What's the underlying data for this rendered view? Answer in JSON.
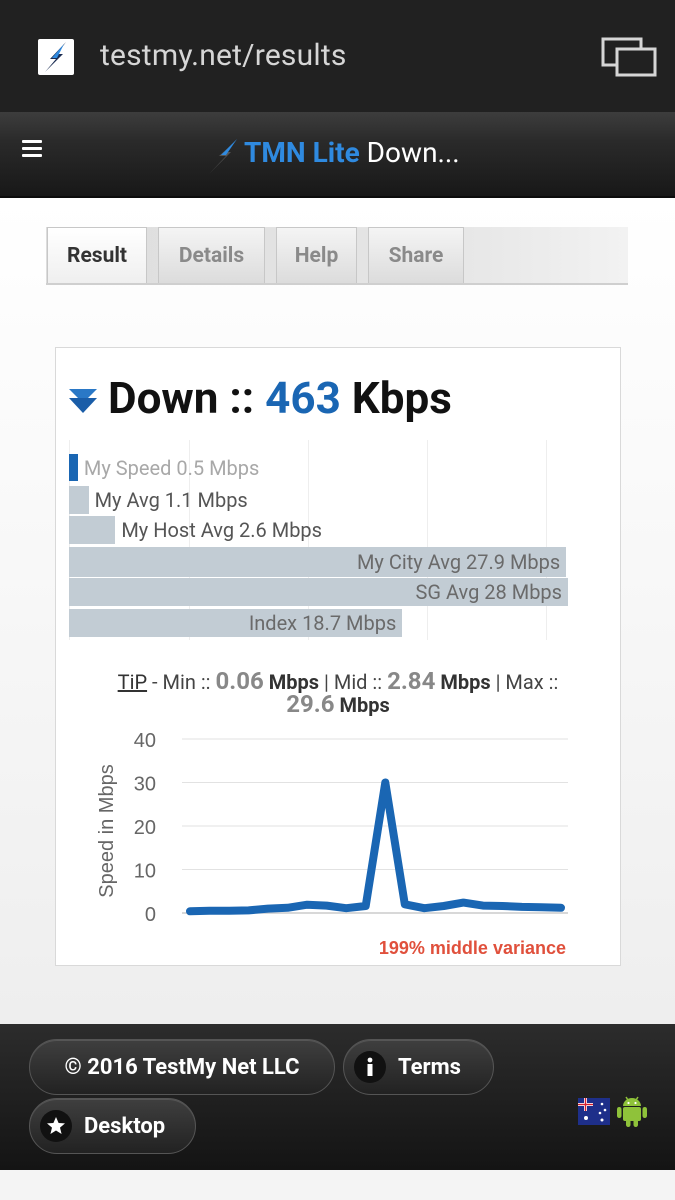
{
  "browser": {
    "url": "testmy.net/results"
  },
  "header": {
    "title_brand": "TMN Lite",
    "title_rest": " Down..."
  },
  "tabs": [
    {
      "label": "Result",
      "active": true
    },
    {
      "label": "Details",
      "active": false
    },
    {
      "label": "Help",
      "active": false
    },
    {
      "label": "Share",
      "active": false
    }
  ],
  "result": {
    "direction_label": "Down ::",
    "speed_value": "463",
    "speed_unit": "Kbps"
  },
  "comparison_bars": [
    {
      "label": "My Speed 0.5 Mbps",
      "value": 0.5
    },
    {
      "label": "My Avg 1.1 Mbps",
      "value": 1.1
    },
    {
      "label": "My Host Avg 2.6 Mbps",
      "value": 2.6
    },
    {
      "label": "My City Avg 27.9 Mbps",
      "value": 27.9
    },
    {
      "label": "SG Avg 28 Mbps",
      "value": 28
    },
    {
      "label": "Index 18.7 Mbps",
      "value": 18.7
    }
  ],
  "tip": {
    "tip_label": "TiP",
    "min_label": " - Min :: ",
    "min_value": "0.06",
    "mid_label": " | Mid :: ",
    "mid_value": "2.84",
    "max_label": " | Max :: ",
    "max_value": "29.6",
    "unit": "Mbps"
  },
  "chart_data": {
    "type": "line",
    "ylabel": "Speed in Mbps",
    "ylim": [
      0,
      40
    ],
    "yticks": [
      0,
      10,
      20,
      30,
      40
    ],
    "x": [
      1,
      2,
      3,
      4,
      5,
      6,
      7,
      8,
      9,
      10,
      11,
      12,
      13,
      14,
      15,
      16,
      17,
      18,
      19,
      20
    ],
    "values": [
      0.4,
      0.5,
      0.5,
      0.6,
      1.0,
      1.2,
      1.9,
      1.7,
      1.1,
      1.6,
      30,
      2.0,
      1.1,
      1.6,
      2.4,
      1.7,
      1.6,
      1.4,
      1.3,
      1.2
    ],
    "series_color": "#1a66b3",
    "annotation": "199% middle variance",
    "annotation_color": "#e0503c"
  },
  "colors": {
    "accent": "#1a66b3",
    "brand_blue": "#2f8ae0",
    "bar_gray": "#c2ccd4"
  },
  "footer": {
    "copyright": "© 2016 TestMy Net LLC",
    "terms": "Terms",
    "desktop": "Desktop",
    "icons": [
      "info-icon",
      "star-icon",
      "australia-flag-icon",
      "android-icon"
    ]
  }
}
